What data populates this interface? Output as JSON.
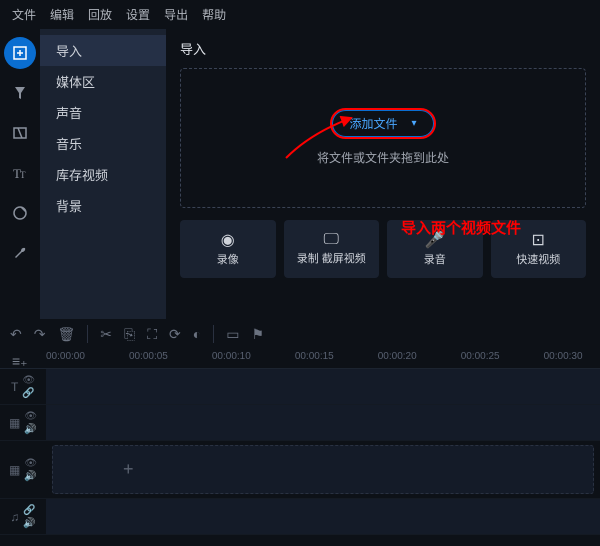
{
  "menubar": [
    "文件",
    "编辑",
    "回放",
    "设置",
    "导出",
    "帮助"
  ],
  "sidebar": {
    "items": [
      "导入",
      "媒体区",
      "声音",
      "音乐",
      "库存视频",
      "背景"
    ],
    "active_index": 0
  },
  "content": {
    "title": "导入",
    "add_file_btn": "添加文件",
    "drop_hint": "将文件或文件夹拖到此处"
  },
  "annotation": "导入两个视频文件",
  "capture": [
    {
      "icon": "camera",
      "label": "录像"
    },
    {
      "icon": "monitor",
      "label": "录制\n截屏视频"
    },
    {
      "icon": "mic",
      "label": "录音"
    },
    {
      "icon": "bolt",
      "label": "快速视频"
    }
  ],
  "ruler": [
    "00:00:00",
    "00:00:05",
    "00:00:10",
    "00:00:15",
    "00:00:20",
    "00:00:25",
    "00:00:30"
  ]
}
